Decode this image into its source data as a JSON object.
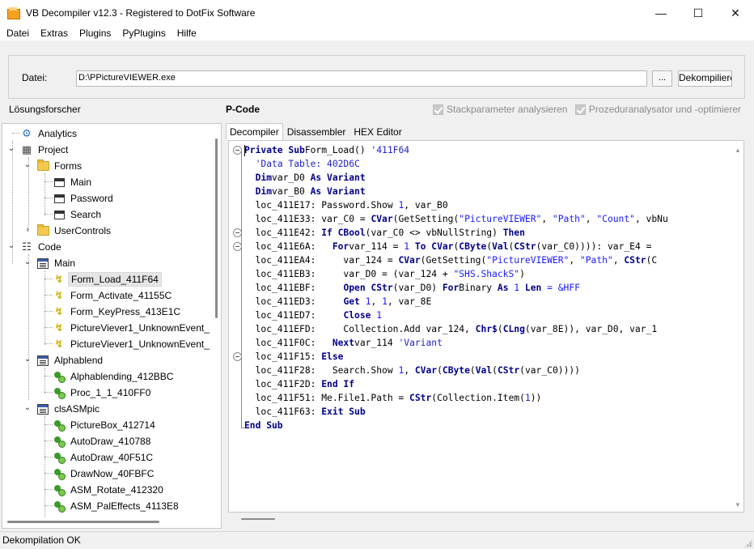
{
  "window": {
    "title": "VB Decompiler v12.3 - Registered to DotFix Software",
    "minimize_icon": "minimize-icon",
    "maximize_icon": "maximize-icon",
    "close_icon": "close-icon"
  },
  "menu": [
    "Datei",
    "Extras",
    "Plugins",
    "PyPlugins",
    "Hilfe"
  ],
  "file": {
    "label": "Datei:",
    "path": "D:\\PPictureVIEWER.exe",
    "browse_label": "...",
    "decompile_label": "Dekompiliere"
  },
  "solution_label": "Lösungsforscher",
  "pcode_label": "P-Code",
  "options": {
    "stack_params": "Stackparameter analysieren",
    "proc_analyzer": "Prozeduranalysator und -optimierer"
  },
  "tree": [
    {
      "label": "Analytics",
      "icon": "analytics-icon"
    },
    {
      "label": "Project",
      "icon": "project-icon"
    },
    {
      "label": "Forms",
      "icon": "folder-icon"
    },
    {
      "label": "Main",
      "icon": "form-icon"
    },
    {
      "label": "Password",
      "icon": "form-icon"
    },
    {
      "label": "Search",
      "icon": "form-icon"
    },
    {
      "label": "UserControls",
      "icon": "folder-icon"
    },
    {
      "label": "Code",
      "icon": "code-icon"
    },
    {
      "label": "Main",
      "icon": "module-icon"
    },
    {
      "label": "Form_Load_411F64",
      "icon": "event-icon"
    },
    {
      "label": "Form_Activate_41155C",
      "icon": "event-icon"
    },
    {
      "label": "Form_KeyPress_413E1C",
      "icon": "event-icon"
    },
    {
      "label": "PictureViever1_UnknownEvent_",
      "icon": "event-icon"
    },
    {
      "label": "PictureViever1_UnknownEvent_",
      "icon": "event-icon"
    },
    {
      "label": "Alphablend",
      "icon": "module-icon"
    },
    {
      "label": "Alphablending_412BBC",
      "icon": "procedure-icon"
    },
    {
      "label": "Proc_1_1_410FF0",
      "icon": "procedure-icon"
    },
    {
      "label": "clsASMpic",
      "icon": "module-icon"
    },
    {
      "label": "PictureBox_412714",
      "icon": "procedure-icon"
    },
    {
      "label": "AutoDraw_410788",
      "icon": "procedure-icon"
    },
    {
      "label": "AutoDraw_40F51C",
      "icon": "procedure-icon"
    },
    {
      "label": "DrawNow_40FBFC",
      "icon": "procedure-icon"
    },
    {
      "label": "ASM_Rotate_412320",
      "icon": "procedure-icon"
    },
    {
      "label": "ASM_PalEffects_4113E8",
      "icon": "procedure-icon"
    }
  ],
  "tabs": [
    "Decompiler",
    "Disassembler",
    "HEX Editor"
  ],
  "code": [
    [
      [
        "kw",
        "Private Sub"
      ],
      [
        "",
        "Form_Load() "
      ],
      [
        "cm",
        "'411F64"
      ]
    ],
    [
      [
        "",
        "  "
      ],
      [
        "cm",
        "'Data Table: 402D6C"
      ]
    ],
    [
      [
        "",
        "  "
      ],
      [
        "kw",
        "Dim"
      ],
      [
        "",
        "var_D0 "
      ],
      [
        "kw",
        "As Variant"
      ]
    ],
    [
      [
        "",
        "  "
      ],
      [
        "kw",
        "Dim"
      ],
      [
        "",
        "var_B0 "
      ],
      [
        "kw",
        "As Variant"
      ]
    ],
    [
      [
        "",
        "  loc_411E17: Password.Show "
      ],
      [
        "nm",
        "1"
      ],
      [
        "",
        ", var_B0"
      ]
    ],
    [
      [
        "",
        "  loc_411E33: var_C0 = "
      ],
      [
        "kw",
        "CVar"
      ],
      [
        "",
        "(GetSetting("
      ],
      [
        "st",
        "\"PictureVIEWER\""
      ],
      [
        "",
        ", "
      ],
      [
        "st",
        "\"Path\""
      ],
      [
        "",
        ", "
      ],
      [
        "st",
        "\"Count\""
      ],
      [
        "",
        ", vbNu"
      ]
    ],
    [
      [
        "",
        "  loc_411E42: "
      ],
      [
        "kw",
        "If CBool"
      ],
      [
        "",
        "(var_C0 <> vbNullString) "
      ],
      [
        "kw",
        "Then"
      ]
    ],
    [
      [
        "",
        "  loc_411E6A:   "
      ],
      [
        "kw",
        "For"
      ],
      [
        "",
        "var_114 = "
      ],
      [
        "nm",
        "1"
      ],
      [
        "",
        ""
      ],
      [
        "kw",
        " To CVar"
      ],
      [
        "",
        "("
      ],
      [
        "kw",
        "CByte"
      ],
      [
        "",
        "("
      ],
      [
        "kw",
        "Val"
      ],
      [
        "",
        "("
      ],
      [
        "kw",
        "CStr"
      ],
      [
        "",
        "(var_C0)))): var_E4 = "
      ]
    ],
    [
      [
        "",
        "  loc_411EA4:     var_124 = "
      ],
      [
        "kw",
        "CVar"
      ],
      [
        "",
        "(GetSetting("
      ],
      [
        "st",
        "\"PictureVIEWER\""
      ],
      [
        "",
        ", "
      ],
      [
        "st",
        "\"Path\""
      ],
      [
        "",
        ", "
      ],
      [
        "kw",
        "CStr"
      ],
      [
        "",
        "(C"
      ]
    ],
    [
      [
        "",
        "  loc_411EB3:     var_D0 = (var_124 + "
      ],
      [
        "st",
        "\"SHS.ShackS\""
      ],
      [
        "",
        ")"
      ]
    ],
    [
      [
        "",
        "  loc_411EBF:     "
      ],
      [
        "kw",
        "Open CStr"
      ],
      [
        "",
        "(var_D0) "
      ],
      [
        "kw",
        "For"
      ],
      [
        "",
        "Binary "
      ],
      [
        "kw",
        "As"
      ],
      [
        "",
        ""
      ],
      [
        "nm",
        " 1"
      ],
      [
        "",
        ""
      ],
      [
        "kw",
        " Len"
      ],
      [
        "",
        ""
      ],
      [
        "nm",
        " = &HFF"
      ]
    ],
    [
      [
        "",
        "  loc_411ED3:     "
      ],
      [
        "kw",
        "Get"
      ],
      [
        "",
        ""
      ],
      [
        "nm",
        " 1"
      ],
      [
        "",
        ", "
      ],
      [
        "nm",
        "1"
      ],
      [
        "",
        ", var_8E"
      ]
    ],
    [
      [
        "",
        "  loc_411ED7:     "
      ],
      [
        "kw",
        "Close"
      ],
      [
        "",
        ""
      ],
      [
        "nm",
        " 1"
      ]
    ],
    [
      [
        "",
        "  loc_411EFD:     Collection.Add var_124, "
      ],
      [
        "kw",
        "Chr$"
      ],
      [
        "",
        "("
      ],
      [
        "kw",
        "CLng"
      ],
      [
        "",
        "(var_8E)), var_D0, var_1"
      ]
    ],
    [
      [
        "",
        "  loc_411F0C:   "
      ],
      [
        "kw",
        "Next"
      ],
      [
        "",
        "var_114 "
      ],
      [
        "cm",
        "'Variant"
      ]
    ],
    [
      [
        "",
        "  loc_411F15: "
      ],
      [
        "kw",
        "Else"
      ]
    ],
    [
      [
        "",
        "  loc_411F28:   Search.Show "
      ],
      [
        "nm",
        "1"
      ],
      [
        "",
        ", "
      ],
      [
        "kw",
        "CVar"
      ],
      [
        "",
        "("
      ],
      [
        "kw",
        "CByte"
      ],
      [
        "",
        "("
      ],
      [
        "kw",
        "Val"
      ],
      [
        "",
        "("
      ],
      [
        "kw",
        "CStr"
      ],
      [
        "",
        "(var_C0))))"
      ]
    ],
    [
      [
        "",
        "  loc_411F2D: "
      ],
      [
        "kw",
        "End If"
      ]
    ],
    [
      [
        "",
        "  loc_411F51: Me.File1.Path = "
      ],
      [
        "kw",
        "CStr"
      ],
      [
        "",
        "(Collection.Item("
      ],
      [
        "nm",
        "1"
      ],
      [
        "",
        "))"
      ]
    ],
    [
      [
        "",
        "  loc_411F63: "
      ],
      [
        "kw",
        "Exit Sub"
      ]
    ],
    [
      [
        "kw",
        "End Sub"
      ]
    ]
  ],
  "status": "Dekompilation OK"
}
